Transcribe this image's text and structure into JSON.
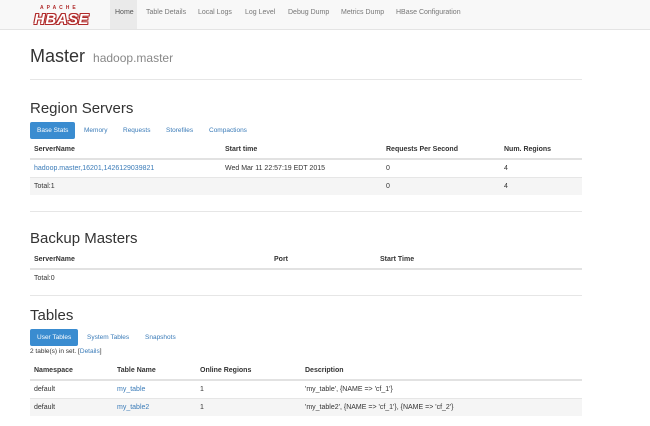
{
  "navbar": {
    "logo_top": "APACHE",
    "logo_main": "HBASE",
    "items": [
      {
        "label": "Home"
      },
      {
        "label": "Table Details"
      },
      {
        "label": "Local Logs"
      },
      {
        "label": "Log Level"
      },
      {
        "label": "Debug Dump"
      },
      {
        "label": "Metrics Dump"
      },
      {
        "label": "HBase Configuration"
      }
    ]
  },
  "page": {
    "title": "Master",
    "subtitle": "hadoop.master"
  },
  "region_servers": {
    "heading": "Region Servers",
    "tabs": [
      "Base Stats",
      "Memory",
      "Requests",
      "Storefiles",
      "Compactions"
    ],
    "columns": [
      "ServerName",
      "Start time",
      "Requests Per Second",
      "Num. Regions"
    ],
    "rows": [
      {
        "server": "hadoop.master,16201,1426129039821",
        "start": "Wed Mar 11 22:57:19 EDT 2015",
        "rps": "0",
        "regions": "4"
      }
    ],
    "total": {
      "label": "Total:1",
      "rps": "0",
      "regions": "4"
    }
  },
  "backup_masters": {
    "heading": "Backup Masters",
    "columns": [
      "ServerName",
      "Port",
      "Start Time"
    ],
    "total": "Total:0"
  },
  "tables": {
    "heading": "Tables",
    "tabs": [
      "User Tables",
      "System Tables",
      "Snapshots"
    ],
    "count_text": "2 table(s) in set.",
    "details_link": "Details",
    "columns": [
      "Namespace",
      "Table Name",
      "Online Regions",
      "Description"
    ],
    "rows": [
      {
        "namespace": "default",
        "name": "my_table",
        "regions": "1",
        "description": "'my_table', {NAME => 'cf_1'}"
      },
      {
        "namespace": "default",
        "name": "my_table2",
        "regions": "1",
        "description": "'my_table2', {NAME => 'cf_1'}, {NAME => 'cf_2'}"
      }
    ]
  },
  "colors": {
    "accent": "#3a8cd0",
    "link": "#3a7bb8",
    "brand": "#b02a2a"
  }
}
